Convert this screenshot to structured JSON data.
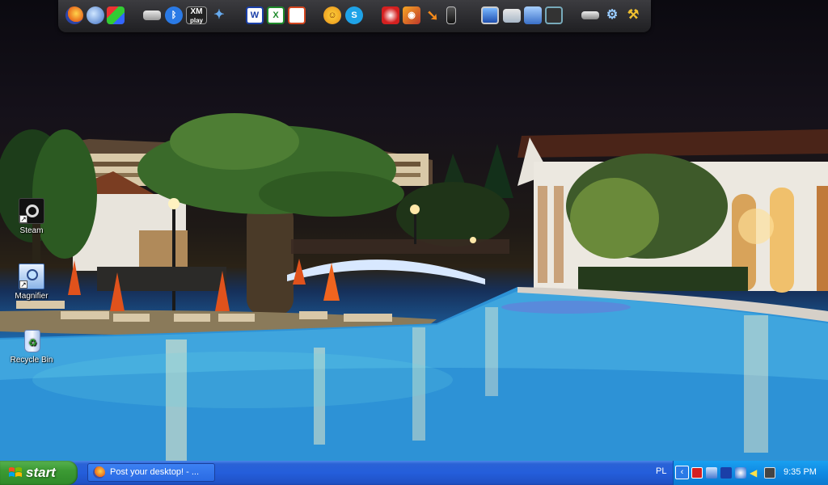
{
  "desktop": {
    "icons": [
      {
        "label": "Steam",
        "icon": "steam-icon"
      },
      {
        "label": "Magnifier",
        "icon": "magnifier-icon"
      },
      {
        "label": "Recycle Bin",
        "icon": "recycle-bin-icon"
      }
    ]
  },
  "dock": {
    "xmplay_text": "XM",
    "xmplay_sub": "play",
    "word_letter": "W",
    "excel_letter": "X",
    "icons": [
      "firefox-icon",
      "thunderbird-icon",
      "paint-icon",
      "drive-icon",
      "bluetooth-icon",
      "xmplay-icon",
      "joystick-icon",
      "word-icon",
      "excel-icon",
      "powerpoint-icon",
      "smiley-icon",
      "skype-icon",
      "media-icon",
      "eye-icon",
      "arrow-icon",
      "phone-icon",
      "monitor-icon",
      "folder-icon",
      "network-icon",
      "video-icon",
      "scanner-icon",
      "settings-icon",
      "tools-icon"
    ]
  },
  "taskbar": {
    "start_label": "start",
    "task_button_label": "Post your desktop! - ...",
    "language": "PL",
    "clock": "9:35 PM"
  },
  "colors": {
    "taskbar_blue": "#245edb",
    "start_green": "#3c9a34",
    "tray_blue": "#0f8ae3",
    "pool_blue": "#3fa7df"
  }
}
